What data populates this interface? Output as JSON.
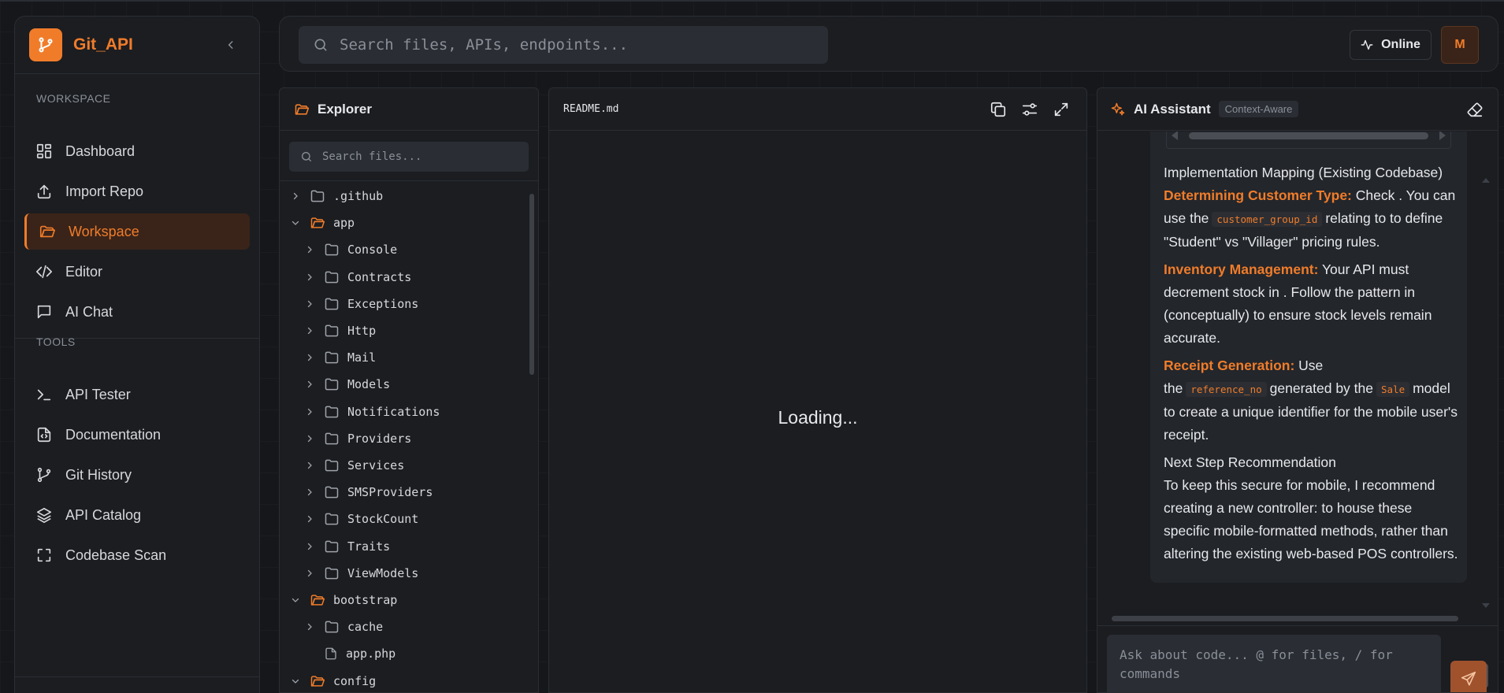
{
  "colors": {
    "accent": "#f07c2a",
    "bg": "#15171b",
    "panel": "#1b1d21",
    "muted": "#8a8f98"
  },
  "app": {
    "name": "Git_API"
  },
  "sidebar": {
    "workspace_title": "WORKSPACE",
    "tools_title": "TOOLS",
    "workspace_items": [
      {
        "label": "Dashboard",
        "icon": "grid-icon"
      },
      {
        "label": "Import Repo",
        "icon": "upload-icon"
      },
      {
        "label": "Workspace",
        "icon": "folder-icon",
        "active": true
      },
      {
        "label": "Editor",
        "icon": "code-icon"
      },
      {
        "label": "AI Chat",
        "icon": "message-icon"
      }
    ],
    "tool_items": [
      {
        "label": "API Tester",
        "icon": "terminal-icon"
      },
      {
        "label": "Documentation",
        "icon": "file-code-icon"
      },
      {
        "label": "Git History",
        "icon": "git-branch-icon"
      },
      {
        "label": "API Catalog",
        "icon": "layers-icon"
      },
      {
        "label": "Codebase Scan",
        "icon": "scan-icon"
      }
    ]
  },
  "topbar": {
    "search_placeholder": "Search files, APIs, endpoints...",
    "status_label": "Online",
    "avatar_initial": "M"
  },
  "explorer": {
    "title": "Explorer",
    "search_placeholder": "Search files...",
    "tree": [
      {
        "name": ".github",
        "type": "folder",
        "depth": 0,
        "expanded": false
      },
      {
        "name": "app",
        "type": "folder",
        "depth": 0,
        "expanded": true
      },
      {
        "name": "Console",
        "type": "folder",
        "depth": 1,
        "expanded": false
      },
      {
        "name": "Contracts",
        "type": "folder",
        "depth": 1,
        "expanded": false
      },
      {
        "name": "Exceptions",
        "type": "folder",
        "depth": 1,
        "expanded": false
      },
      {
        "name": "Http",
        "type": "folder",
        "depth": 1,
        "expanded": false
      },
      {
        "name": "Mail",
        "type": "folder",
        "depth": 1,
        "expanded": false
      },
      {
        "name": "Models",
        "type": "folder",
        "depth": 1,
        "expanded": false
      },
      {
        "name": "Notifications",
        "type": "folder",
        "depth": 1,
        "expanded": false
      },
      {
        "name": "Providers",
        "type": "folder",
        "depth": 1,
        "expanded": false
      },
      {
        "name": "Services",
        "type": "folder",
        "depth": 1,
        "expanded": false
      },
      {
        "name": "SMSProviders",
        "type": "folder",
        "depth": 1,
        "expanded": false
      },
      {
        "name": "StockCount",
        "type": "folder",
        "depth": 1,
        "expanded": false
      },
      {
        "name": "Traits",
        "type": "folder",
        "depth": 1,
        "expanded": false
      },
      {
        "name": "ViewModels",
        "type": "folder",
        "depth": 1,
        "expanded": false
      },
      {
        "name": "bootstrap",
        "type": "folder",
        "depth": 0,
        "expanded": true
      },
      {
        "name": "cache",
        "type": "folder",
        "depth": 1,
        "expanded": false
      },
      {
        "name": "app.php",
        "type": "file",
        "depth": 1
      },
      {
        "name": "config",
        "type": "folder",
        "depth": 0,
        "expanded": true
      }
    ]
  },
  "editor": {
    "filename": "README.md",
    "loading_text": "Loading..."
  },
  "assistant": {
    "title": "AI Assistant",
    "badge": "Context-Aware",
    "section1_heading": "Implementation Mapping (Existing Codebase)",
    "p1_label": "Determining Customer Type:",
    "p1_a": "Check . You can use the",
    "p1_code": "customer_group_id",
    "p1_b": "relating to to define \"Student\" vs \"Villager\" pricing rules.",
    "p2_label": "Inventory Management:",
    "p2_text": "Your API must decrement stock in . Follow the pattern in (conceptually) to ensure stock levels remain accurate.",
    "p3_label": "Receipt Generation:",
    "p3_a": "Use the",
    "p3_code1": "reference_no",
    "p3_b": "generated by the",
    "p3_code2": "Sale",
    "p3_c": "model to create a unique identifier for the mobile user's receipt.",
    "section2_heading": "Next Step Recommendation",
    "p4_text": "To keep this secure for mobile, I recommend creating a new controller: to house these specific mobile-formatted methods, rather than altering the existing web-based POS controllers.",
    "input_placeholder": "Ask about code... @ for files, / for commands"
  }
}
